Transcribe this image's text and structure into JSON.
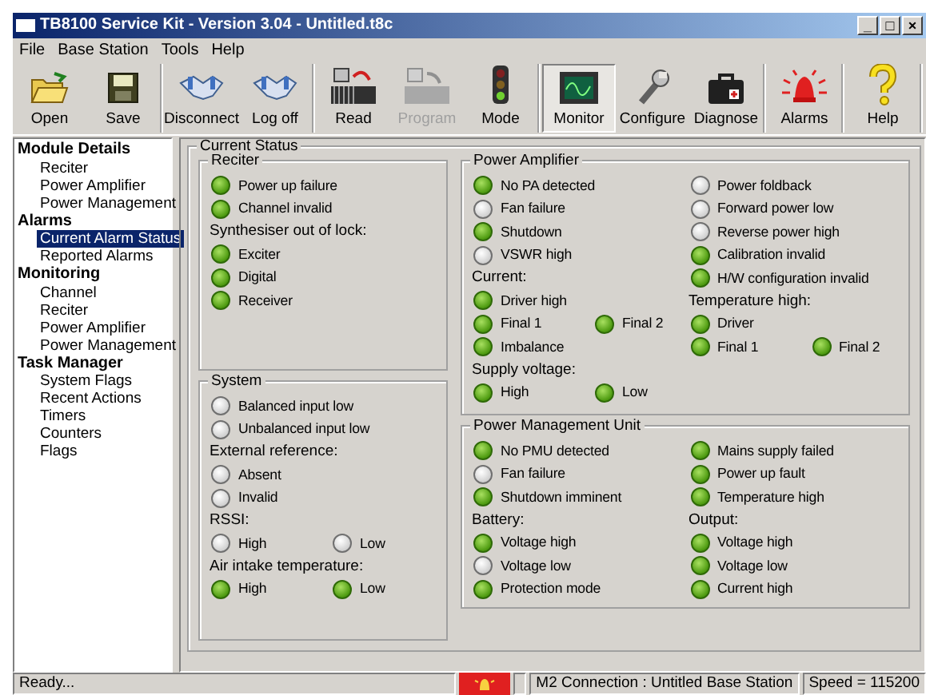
{
  "window": {
    "title": "TB8100 Service Kit - Version 3.04 - Untitled.t8c",
    "controls": [
      "_",
      "□",
      "×"
    ]
  },
  "menu": [
    "File",
    "Base Station",
    "Tools",
    "Help"
  ],
  "toolbar": [
    [
      {
        "label": "Open",
        "selected": false,
        "disabled": false
      },
      {
        "label": "Save",
        "selected": false,
        "disabled": false
      }
    ],
    [
      {
        "label": "Disconnect",
        "selected": false,
        "disabled": false
      },
      {
        "label": "Log off",
        "selected": false,
        "disabled": false
      }
    ],
    [
      {
        "label": "Read",
        "selected": false,
        "disabled": false
      },
      {
        "label": "Program",
        "selected": false,
        "disabled": true
      },
      {
        "label": "Mode",
        "selected": false,
        "disabled": false
      }
    ],
    [
      {
        "label": "Monitor",
        "selected": true,
        "disabled": false
      },
      {
        "label": "Configure",
        "selected": false,
        "disabled": false
      },
      {
        "label": "Diagnose",
        "selected": false,
        "disabled": false
      }
    ],
    [
      {
        "label": "Alarms",
        "selected": false,
        "disabled": false
      }
    ],
    [
      {
        "label": "Help",
        "selected": false,
        "disabled": false
      }
    ]
  ],
  "sidebar": {
    "sections": [
      {
        "label": "Module Details",
        "children": [
          {
            "label": "Reciter",
            "selected": false
          },
          {
            "label": "Power Amplifier",
            "selected": false
          },
          {
            "label": "Power Management",
            "selected": false
          }
        ]
      },
      {
        "label": "Alarms",
        "children": [
          {
            "label": "Current Alarm Status",
            "selected": true
          },
          {
            "label": "Reported Alarms",
            "selected": false
          }
        ]
      },
      {
        "label": "Monitoring",
        "children": [
          {
            "label": "Channel",
            "selected": false
          },
          {
            "label": "Reciter",
            "selected": false
          },
          {
            "label": "Power Amplifier",
            "selected": false
          },
          {
            "label": "Power Management",
            "selected": false
          }
        ]
      },
      {
        "label": "Task Manager",
        "children": [
          {
            "label": "System Flags",
            "selected": false
          },
          {
            "label": "Recent Actions",
            "selected": false
          },
          {
            "label": "Timers",
            "selected": false
          },
          {
            "label": "Counters",
            "selected": false
          },
          {
            "label": "Flags",
            "selected": false
          }
        ]
      }
    ]
  },
  "current_status": {
    "title": "Current Status",
    "groups": [
      {
        "title": "Reciter",
        "columns": [
          [
            {
              "kind": "leds",
              "leds": [
                {
                  "label": "Power up failure",
                  "lit": true
                }
              ]
            },
            {
              "kind": "leds",
              "leds": [
                {
                  "label": "Channel invalid",
                  "lit": true
                }
              ]
            },
            {
              "kind": "heading",
              "text": "Synthesiser out of lock:"
            },
            {
              "kind": "leds",
              "leds": [
                {
                  "label": "Exciter",
                  "lit": true
                }
              ]
            },
            {
              "kind": "leds",
              "leds": [
                {
                  "label": "Digital",
                  "lit": true
                }
              ]
            },
            {
              "kind": "leds",
              "leds": [
                {
                  "label": "Receiver",
                  "lit": true
                }
              ]
            }
          ]
        ]
      },
      {
        "title": "System",
        "columns": [
          [
            {
              "kind": "leds",
              "leds": [
                {
                  "label": "Balanced input low",
                  "lit": false
                }
              ]
            },
            {
              "kind": "leds",
              "leds": [
                {
                  "label": "Unbalanced input low",
                  "lit": false
                }
              ]
            },
            {
              "kind": "heading",
              "text": "External reference:"
            },
            {
              "kind": "leds",
              "leds": [
                {
                  "label": "Absent",
                  "lit": false
                }
              ]
            },
            {
              "kind": "leds",
              "leds": [
                {
                  "label": "Invalid",
                  "lit": false
                }
              ]
            },
            {
              "kind": "heading",
              "text": "RSSI:"
            },
            {
              "kind": "leds",
              "leds": [
                {
                  "label": "High",
                  "lit": false
                },
                {
                  "label": "Low",
                  "lit": false
                }
              ]
            },
            {
              "kind": "heading",
              "text": "Air intake temperature:"
            },
            {
              "kind": "leds",
              "leds": [
                {
                  "label": "High",
                  "lit": true
                },
                {
                  "label": "Low",
                  "lit": true
                }
              ]
            }
          ]
        ]
      },
      {
        "title": "Power Amplifier",
        "columns": [
          [
            {
              "kind": "leds",
              "leds": [
                {
                  "label": "No PA detected",
                  "lit": true
                }
              ]
            },
            {
              "kind": "leds",
              "leds": [
                {
                  "label": "Fan failure",
                  "lit": false
                }
              ]
            },
            {
              "kind": "leds",
              "leds": [
                {
                  "label": "Shutdown",
                  "lit": true
                }
              ]
            },
            {
              "kind": "leds",
              "leds": [
                {
                  "label": "VSWR high",
                  "lit": false
                }
              ]
            },
            {
              "kind": "heading",
              "text": "Current:"
            },
            {
              "kind": "leds",
              "leds": [
                {
                  "label": "Driver high",
                  "lit": true
                }
              ]
            },
            {
              "kind": "leds",
              "leds": [
                {
                  "label": "Final 1",
                  "lit": true
                },
                {
                  "label": "Final 2",
                  "lit": true
                }
              ]
            },
            {
              "kind": "leds",
              "leds": [
                {
                  "label": "Imbalance",
                  "lit": true
                }
              ]
            },
            {
              "kind": "heading",
              "text": "Supply voltage:"
            },
            {
              "kind": "leds",
              "leds": [
                {
                  "label": "High",
                  "lit": true
                },
                {
                  "label": "Low",
                  "lit": true
                }
              ]
            }
          ],
          [
            {
              "kind": "leds",
              "leds": [
                {
                  "label": "Power foldback",
                  "lit": false
                }
              ]
            },
            {
              "kind": "leds",
              "leds": [
                {
                  "label": "Forward power low",
                  "lit": false
                }
              ]
            },
            {
              "kind": "leds",
              "leds": [
                {
                  "label": "Reverse power high",
                  "lit": false
                }
              ]
            },
            {
              "kind": "leds",
              "leds": [
                {
                  "label": "Calibration invalid",
                  "lit": true
                }
              ]
            },
            {
              "kind": "leds",
              "leds": [
                {
                  "label": "H/W configuration invalid",
                  "lit": true
                }
              ]
            },
            {
              "kind": "heading",
              "text": "Temperature high:"
            },
            {
              "kind": "leds",
              "leds": [
                {
                  "label": "Driver",
                  "lit": true
                }
              ]
            },
            {
              "kind": "leds",
              "leds": [
                {
                  "label": "Final 1",
                  "lit": true
                },
                {
                  "label": "Final 2",
                  "lit": true
                }
              ]
            }
          ]
        ]
      },
      {
        "title": "Power Management Unit",
        "columns": [
          [
            {
              "kind": "leds",
              "leds": [
                {
                  "label": "No PMU detected",
                  "lit": true
                }
              ]
            },
            {
              "kind": "leds",
              "leds": [
                {
                  "label": "Fan failure",
                  "lit": false
                }
              ]
            },
            {
              "kind": "leds",
              "leds": [
                {
                  "label": "Shutdown imminent",
                  "lit": true
                }
              ]
            },
            {
              "kind": "heading",
              "text": "Battery:"
            },
            {
              "kind": "leds",
              "leds": [
                {
                  "label": "Voltage high",
                  "lit": true
                }
              ]
            },
            {
              "kind": "leds",
              "leds": [
                {
                  "label": "Voltage low",
                  "lit": false
                }
              ]
            },
            {
              "kind": "leds",
              "leds": [
                {
                  "label": "Protection mode",
                  "lit": true
                }
              ]
            }
          ],
          [
            {
              "kind": "leds",
              "leds": [
                {
                  "label": "Mains supply failed",
                  "lit": true
                }
              ]
            },
            {
              "kind": "leds",
              "leds": [
                {
                  "label": "Power up fault",
                  "lit": true
                }
              ]
            },
            {
              "kind": "leds",
              "leds": [
                {
                  "label": "Temperature high",
                  "lit": true
                }
              ]
            },
            {
              "kind": "heading",
              "text": "Output:"
            },
            {
              "kind": "leds",
              "leds": [
                {
                  "label": "Voltage high",
                  "lit": true
                }
              ]
            },
            {
              "kind": "leds",
              "leds": [
                {
                  "label": "Voltage low",
                  "lit": true
                }
              ]
            },
            {
              "kind": "leds",
              "leds": [
                {
                  "label": "Current high",
                  "lit": true
                }
              ]
            }
          ]
        ]
      }
    ]
  },
  "status_bar": {
    "message": "Ready...",
    "connection": "M2 Connection : Untitled Base Station",
    "speed": "Speed = 115200"
  }
}
